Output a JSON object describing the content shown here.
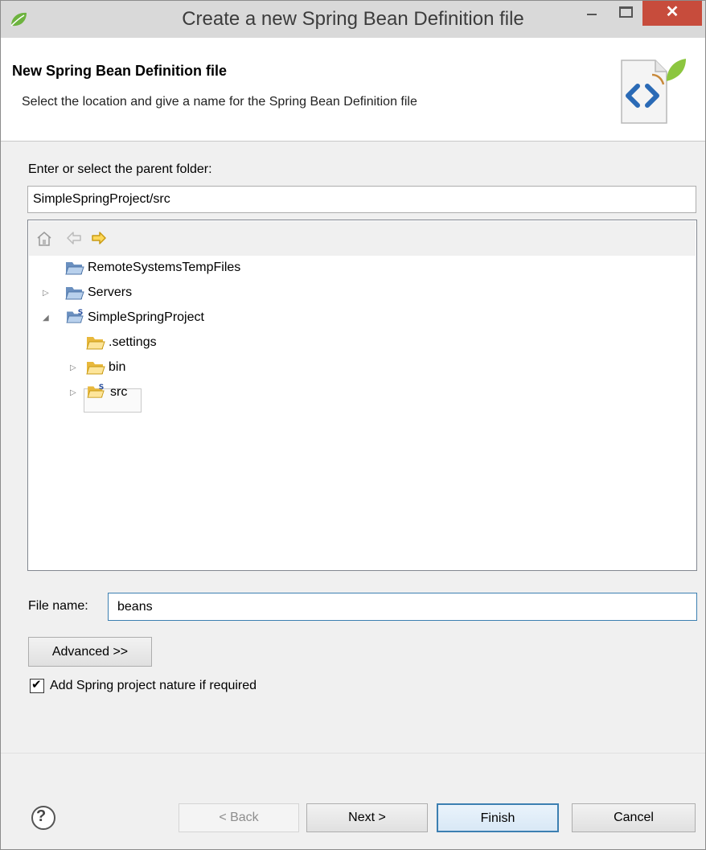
{
  "window": {
    "title": "Create a new Spring Bean Definition file",
    "close_symbol": "✕",
    "accent_close": "#c74c3c"
  },
  "banner": {
    "title": "New Spring Bean Definition file",
    "description": "Select the location and give a name for the Spring Bean Definition file",
    "icon": "spring-xml-file-icon"
  },
  "folder": {
    "label": "Enter or select the parent folder:",
    "value": "SimpleSpringProject/src"
  },
  "tree": {
    "toolbar_icons": [
      "home-icon",
      "back-arrow-icon",
      "forward-arrow-icon"
    ],
    "items": [
      {
        "label": "RemoteSystemsTempFiles",
        "icon": "project-folder-icon",
        "expander": ""
      },
      {
        "label": "Servers",
        "icon": "project-folder-icon",
        "expander": "▷"
      },
      {
        "label": "SimpleSpringProject",
        "icon": "spring-project-icon",
        "expander": "◢"
      },
      {
        "label": ".settings",
        "icon": "folder-icon",
        "expander": ""
      },
      {
        "label": "bin",
        "icon": "folder-icon",
        "expander": "▷"
      },
      {
        "label": "src",
        "icon": "spring-source-folder-icon",
        "expander": "▷",
        "selected": true
      }
    ]
  },
  "file_name": {
    "label": "File name:",
    "value": "beans"
  },
  "advanced_button": "Advanced >>",
  "checkbox": {
    "label": "Add Spring project nature if required",
    "checked": true,
    "check_symbol": "✔"
  },
  "buttons": {
    "help": "?",
    "back": "< Back",
    "next": "Next >",
    "finish": "Finish",
    "cancel": "Cancel"
  }
}
